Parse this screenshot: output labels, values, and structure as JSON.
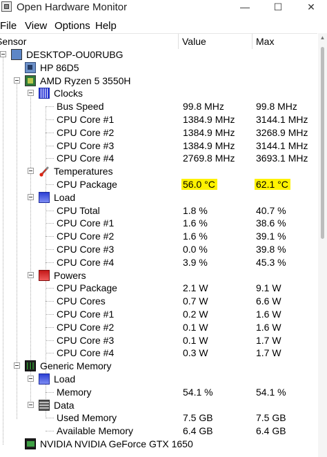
{
  "window": {
    "title": "Open Hardware Monitor",
    "minimize": "—",
    "maximize": "☐",
    "close": "✕"
  },
  "menu": [
    "File",
    "View",
    "Options",
    "Help"
  ],
  "columns": {
    "sensor": "Sensor",
    "value": "Value",
    "max": "Max"
  },
  "highlight_color": "#fff200",
  "rows": [
    {
      "label": "DESKTOP-OU0RUBG",
      "value": "",
      "max": "",
      "icon": "computer-icon",
      "depth": 0,
      "expander": true
    },
    {
      "label": "HP 86D5",
      "value": "",
      "max": "",
      "icon": "mainboard-icon",
      "depth": 1,
      "expander": false
    },
    {
      "label": "AMD Ryzen 5 3550H",
      "value": "",
      "max": "",
      "icon": "cpu-icon",
      "depth": 1,
      "expander": true
    },
    {
      "label": "Clocks",
      "value": "",
      "max": "",
      "icon": "clock-icon",
      "depth": 2,
      "expander": true
    },
    {
      "label": "Bus Speed",
      "value": "99.8 MHz",
      "max": "99.8 MHz",
      "depth": 3
    },
    {
      "label": "CPU Core #1",
      "value": "1384.9 MHz",
      "max": "3144.1 MHz",
      "depth": 3
    },
    {
      "label": "CPU Core #2",
      "value": "1384.9 MHz",
      "max": "3268.9 MHz",
      "depth": 3
    },
    {
      "label": "CPU Core #3",
      "value": "1384.9 MHz",
      "max": "3144.1 MHz",
      "depth": 3
    },
    {
      "label": "CPU Core #4",
      "value": "2769.8 MHz",
      "max": "3693.1 MHz",
      "depth": 3
    },
    {
      "label": "Temperatures",
      "value": "",
      "max": "",
      "icon": "thermometer-icon",
      "depth": 2,
      "expander": true
    },
    {
      "label": "CPU Package",
      "value": "56.0 °C",
      "max": "62.1 °C",
      "depth": 3,
      "highlight": true
    },
    {
      "label": "Load",
      "value": "",
      "max": "",
      "icon": "load-icon",
      "depth": 2,
      "expander": true
    },
    {
      "label": "CPU Total",
      "value": "1.8 %",
      "max": "40.7 %",
      "depth": 3
    },
    {
      "label": "CPU Core #1",
      "value": "1.6 %",
      "max": "38.6 %",
      "depth": 3
    },
    {
      "label": "CPU Core #2",
      "value": "1.6 %",
      "max": "39.1 %",
      "depth": 3
    },
    {
      "label": "CPU Core #3",
      "value": "0.0 %",
      "max": "39.8 %",
      "depth": 3
    },
    {
      "label": "CPU Core #4",
      "value": "3.9 %",
      "max": "45.3 %",
      "depth": 3
    },
    {
      "label": "Powers",
      "value": "",
      "max": "",
      "icon": "power-icon",
      "depth": 2,
      "expander": true
    },
    {
      "label": "CPU Package",
      "value": "2.1 W",
      "max": "9.1 W",
      "depth": 3
    },
    {
      "label": "CPU Cores",
      "value": "0.7 W",
      "max": "6.6 W",
      "depth": 3
    },
    {
      "label": "CPU Core #1",
      "value": "0.2 W",
      "max": "1.6 W",
      "depth": 3
    },
    {
      "label": "CPU Core #2",
      "value": "0.1 W",
      "max": "1.6 W",
      "depth": 3
    },
    {
      "label": "CPU Core #3",
      "value": "0.1 W",
      "max": "1.7 W",
      "depth": 3
    },
    {
      "label": "CPU Core #4",
      "value": "0.3 W",
      "max": "1.7 W",
      "depth": 3
    },
    {
      "label": "Generic Memory",
      "value": "",
      "max": "",
      "icon": "ram-icon",
      "depth": 1,
      "expander": true
    },
    {
      "label": "Load",
      "value": "",
      "max": "",
      "icon": "load-icon",
      "depth": 2,
      "expander": true
    },
    {
      "label": "Memory",
      "value": "54.1 %",
      "max": "54.1 %",
      "depth": 3
    },
    {
      "label": "Data",
      "value": "",
      "max": "",
      "icon": "data-icon",
      "depth": 2,
      "expander": true
    },
    {
      "label": "Used Memory",
      "value": "7.5 GB",
      "max": "7.5 GB",
      "depth": 3
    },
    {
      "label": "Available Memory",
      "value": "6.4 GB",
      "max": "6.4 GB",
      "depth": 3
    },
    {
      "label": "NVIDIA NVIDIA GeForce GTX 1650",
      "value": "",
      "max": "",
      "icon": "gpu-icon",
      "depth": 1,
      "expander": false
    }
  ]
}
